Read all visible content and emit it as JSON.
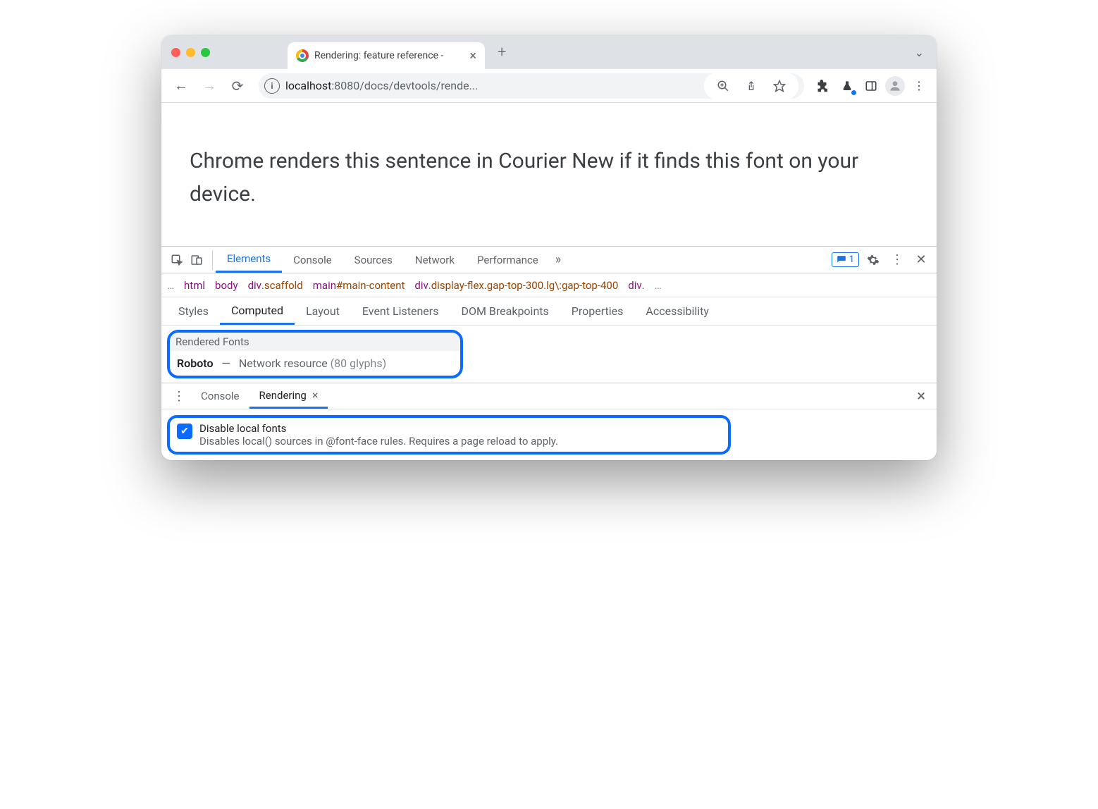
{
  "tab": {
    "title": "Rendering: feature reference -"
  },
  "omnibox": {
    "host": "localhost",
    "port": ":8080",
    "path": "/docs/devtools/rende..."
  },
  "page": {
    "sentence": "Chrome renders this sentence in Courier New if it finds this font on your device."
  },
  "devtools": {
    "tabs": [
      "Elements",
      "Console",
      "Sources",
      "Network",
      "Performance"
    ],
    "active_tab": "Elements",
    "issues_count": "1",
    "breadcrumb": [
      {
        "tag": "html"
      },
      {
        "tag": "body"
      },
      {
        "tag": "div",
        "cls": ".scaffold"
      },
      {
        "tag": "main",
        "sel": "#main-content"
      },
      {
        "tag": "div",
        "cls": ".display-flex.gap-top-300.lg\\:gap-top-400"
      },
      {
        "tag": "div",
        "cls": "."
      }
    ],
    "subtabs": [
      "Styles",
      "Computed",
      "Layout",
      "Event Listeners",
      "DOM Breakpoints",
      "Properties",
      "Accessibility"
    ],
    "active_subtab": "Computed",
    "rendered_fonts": {
      "heading": "Rendered Fonts",
      "font_name": "Roboto",
      "dash": "—",
      "source": "Network resource",
      "glyphs": "(80 glyphs)"
    },
    "drawer_tabs": [
      "Console",
      "Rendering"
    ],
    "active_drawer": "Rendering",
    "option": {
      "title": "Disable local fonts",
      "desc": "Disables local() sources in @font-face rules. Requires a page reload to apply."
    }
  }
}
